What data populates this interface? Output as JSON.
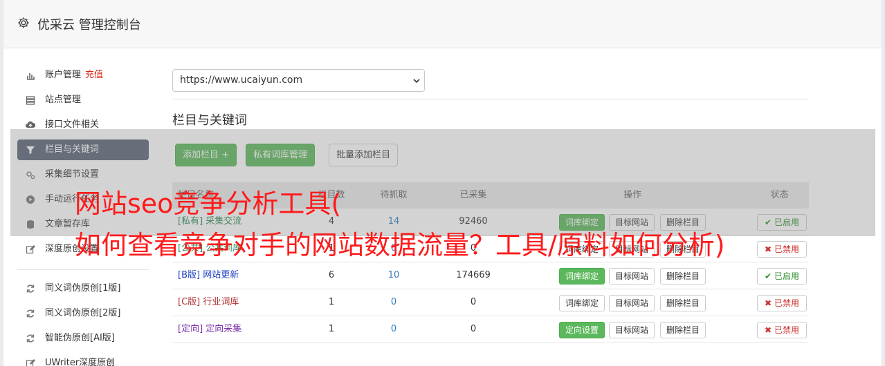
{
  "app": {
    "title": "优采云 管理控制台"
  },
  "sidebar": {
    "items": [
      {
        "label": "账户管理",
        "extra": "充值",
        "icon": "bar-chart-icon"
      },
      {
        "label": "站点管理",
        "icon": "server-icon"
      },
      {
        "label": "接口文件相关",
        "icon": "cloud-upload-icon"
      },
      {
        "label": "栏目与关键词",
        "icon": "filter-icon",
        "active": true
      },
      {
        "label": "采集细节设置",
        "icon": "gears-icon"
      },
      {
        "label": "手动运行任务",
        "icon": "play-circle-icon"
      },
      {
        "label": "文章暂存库",
        "icon": "database-icon"
      },
      {
        "label": "深度原创设置",
        "icon": "edit-icon"
      }
    ],
    "items2": [
      {
        "label": "同义词伪原创[1版]",
        "icon": "refresh-icon"
      },
      {
        "label": "同义词伪原创[2版]",
        "icon": "refresh-icon"
      },
      {
        "label": "智能伪原创[AI版]",
        "icon": "refresh-icon"
      },
      {
        "label": "UWriter深度原创",
        "icon": "edit-icon"
      }
    ]
  },
  "main": {
    "site_select": "https://www.ucaiyun.com",
    "section_title": "栏目与关键词",
    "buttons": {
      "add_column": "添加栏目 +",
      "private_lib": "私有词库管理",
      "batch_add": "批量添加栏目"
    }
  },
  "table": {
    "headers": [
      "栏目名称",
      "栏目数",
      "待抓取",
      "已采集",
      "操作",
      "状态"
    ],
    "rows": [
      {
        "tag": "[私有]",
        "name": "采集交流",
        "color": "#2e8b57",
        "c": "4",
        "pending": "14",
        "collected": "92460",
        "op1": "词库绑定",
        "op1_green": true,
        "op2": "目标网站",
        "op3": "删除栏目",
        "status": "已启用",
        "on": true
      },
      {
        "tag": "[公共]",
        "name": "公共词库",
        "color": "#2e8b57",
        "c": "1",
        "pending": "0",
        "collected": "0",
        "op1": "词库绑定",
        "op1_green": false,
        "op2": "目标网站",
        "op3": "删除栏目",
        "status": "已禁用",
        "on": false
      },
      {
        "tag": "[B版]",
        "name": "网站更新",
        "color": "#1a3fc4",
        "c": "6",
        "pending": "10",
        "collected": "174669",
        "op1": "词库绑定",
        "op1_green": true,
        "op2": "目标网站",
        "op3": "删除栏目",
        "status": "已启用",
        "on": true
      },
      {
        "tag": "[C版]",
        "name": "行业词库",
        "color": "#b03030",
        "c": "1",
        "pending": "0",
        "collected": "0",
        "op1": "词库绑定",
        "op1_green": false,
        "op2": "目标网站",
        "op3": "删除栏目",
        "status": "已禁用",
        "on": false
      },
      {
        "tag": "[定向]",
        "name": "定向采集",
        "color": "#7a2fa8",
        "c": "1",
        "pending": "0",
        "collected": "0",
        "op1": "定向设置",
        "op1_green": true,
        "op2": "目标网站",
        "op3": "删除栏目",
        "status": "已禁用",
        "on": false
      }
    ]
  },
  "overlay": {
    "line1": "网站seo竞争分析工具(",
    "line2": "如何查看竞争对手的网站数据流量？工具/原料如何分析)"
  }
}
